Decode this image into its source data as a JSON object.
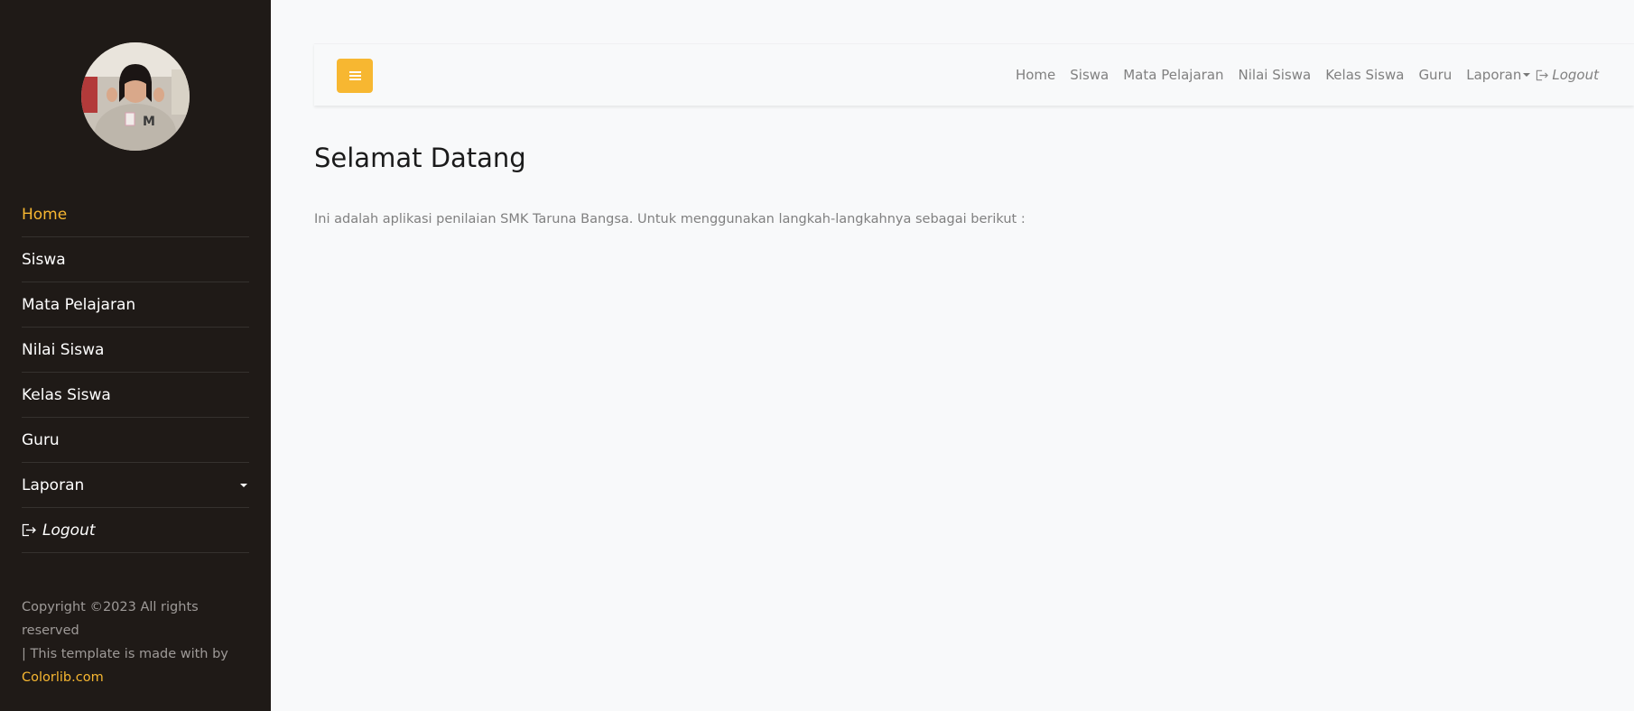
{
  "sidebar": {
    "avatar_alt": "profile photo",
    "items": [
      {
        "label": "Home",
        "active": true
      },
      {
        "label": "Siswa"
      },
      {
        "label": "Mata Pelajaran"
      },
      {
        "label": "Nilai Siswa"
      },
      {
        "label": "Kelas Siswa"
      },
      {
        "label": "Guru"
      },
      {
        "label": "Laporan",
        "has_dropdown": true
      },
      {
        "label": "Logout",
        "icon": "logout-icon"
      }
    ],
    "footer": {
      "copyright": "Copyright ©2023 All rights reserved",
      "made_with": "| This template is made with by",
      "link": "Colorlib.com"
    }
  },
  "navbar": {
    "toggle_icon": "bars-icon",
    "links": [
      "Home",
      "Siswa",
      "Mata Pelajaran",
      "Nilai Siswa",
      "Kelas Siswa",
      "Guru"
    ],
    "dropdown": "Laporan",
    "logout": "Logout"
  },
  "main": {
    "title": "Selamat Datang",
    "intro": "Ini adalah aplikasi penilaian SMK Taruna Bangsa. Untuk menggunakan langkah-langkahnya sebagai berikut :"
  },
  "colors": {
    "accent": "#f7b731",
    "sidebar_bg": "#1f1a17",
    "page_bg": "#f8f9fa"
  }
}
